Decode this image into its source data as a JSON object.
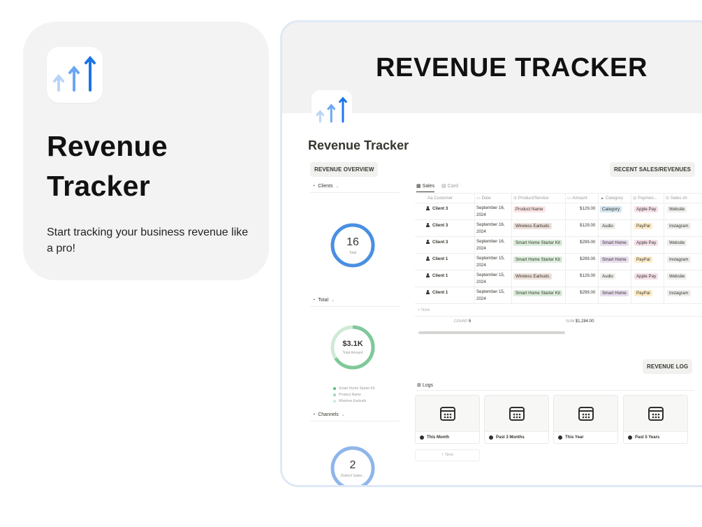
{
  "promo": {
    "title_line1": "Revenue",
    "title_line2": "Tracker",
    "subtitle": "Start tracking your business revenue like a pro!",
    "logo_icon": "rising-arrows-icon"
  },
  "notion": {
    "banner_title": "REVENUE TRACKER",
    "page_title": "Revenue Tracker",
    "overview_button": "REVENUE OVERVIEW",
    "recent_button": "RECENT SALES/REVENUES",
    "log_button": "REVENUE LOG",
    "sections": {
      "clients": "Clients",
      "total": "Total",
      "channels": "Channels"
    },
    "donuts": {
      "clients": {
        "value": "16",
        "label": "Total",
        "color": "#4a8fe2"
      },
      "total": {
        "value": "$3.1K",
        "label": "Total Amount",
        "color": "#7fc99a"
      },
      "channels": {
        "value": "2",
        "label": "Distinct Sales...",
        "color": "#8fb6ea"
      }
    },
    "legend": [
      {
        "label": "Smart Home Starter Kit",
        "color": "#5dbb80"
      },
      {
        "label": "Product Name",
        "color": "#9fd5b2"
      },
      {
        "label": "Wireless Earbuds",
        "color": "#cfead8"
      }
    ],
    "tabs": [
      {
        "label": "Sales",
        "icon": "table-icon"
      },
      {
        "label": "Card",
        "icon": "gallery-icon"
      }
    ],
    "columns": [
      "Customer",
      "Date",
      "Product/Service",
      "Amount",
      "Category",
      "Paymen...",
      "Sales ch"
    ],
    "rows": [
      {
        "customer": "Client 3",
        "date": "September 16, 2024",
        "product": "Product Name",
        "product_color": "#fbe4e4",
        "amount": "$129.00",
        "category": "Category",
        "category_color": "#d3e5ef",
        "payment": "Apple Pay",
        "payment_color": "#f5e0e9",
        "channel": "Website"
      },
      {
        "customer": "Client 3",
        "date": "September 16, 2024",
        "product": "Wireless Earbuds",
        "product_color": "#eee0da",
        "amount": "$129.00",
        "category": "Audio",
        "category_color": "#eeeeec",
        "payment": "PayPal",
        "payment_color": "#fdecc8",
        "channel": "Instagram"
      },
      {
        "customer": "Client 3",
        "date": "September 16, 2024",
        "product": "Smart Home Starter Kit",
        "product_color": "#dbeddb",
        "amount": "$299.00",
        "category": "Smart Home",
        "category_color": "#e8deee",
        "payment": "Apple Pay",
        "payment_color": "#f5e0e9",
        "channel": "Website"
      },
      {
        "customer": "Client 1",
        "date": "September 15, 2024",
        "product": "Smart Home Starter Kit",
        "product_color": "#dbeddb",
        "amount": "$299.00",
        "category": "Smart Home",
        "category_color": "#e8deee",
        "payment": "PayPal",
        "payment_color": "#fdecc8",
        "channel": "Instagram"
      },
      {
        "customer": "Client 1",
        "date": "September 15, 2024",
        "product": "Wireless Earbuds",
        "product_color": "#eee0da",
        "amount": "$129.00",
        "category": "Audio",
        "category_color": "#eeeeec",
        "payment": "Apple Pay",
        "payment_color": "#f5e0e9",
        "channel": "Website"
      },
      {
        "customer": "Client 1",
        "date": "September 15, 2024",
        "product": "Smart Home Starter Kit",
        "product_color": "#dbeddb",
        "amount": "$299.00",
        "category": "Smart Home",
        "category_color": "#e8deee",
        "payment": "PayPal",
        "payment_color": "#fdecc8",
        "channel": "Instagram"
      }
    ],
    "new_label": "+ New",
    "count_label": "COUNT",
    "count_value": "6",
    "sum_label": "SUM",
    "sum_value": "$1,284.00",
    "logs_label": "Logs",
    "log_cards": [
      "This Month",
      "Past 3 Months",
      "This Year",
      "Past 5 Years"
    ],
    "new_card": "+ New"
  }
}
